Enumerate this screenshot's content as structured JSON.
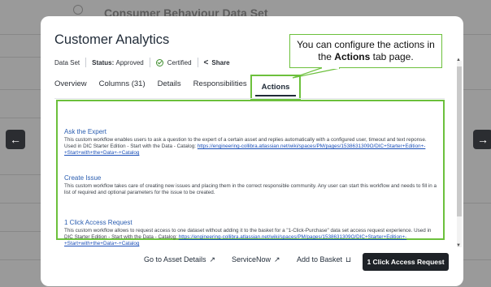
{
  "background": {
    "page_title": "Consumer Behaviour Data Set"
  },
  "navigation": {
    "prev_icon": "←",
    "next_icon": "→"
  },
  "modal": {
    "title": "Customer Analytics",
    "meta": {
      "type": "Data Set",
      "status_label": "Status:",
      "status_value": "Approved",
      "certified": "Certified",
      "share": "Share"
    },
    "tabs": [
      {
        "label": "Overview"
      },
      {
        "label": "Columns (31)"
      },
      {
        "label": "Details"
      },
      {
        "label": "Responsibilities"
      },
      {
        "label": "Actions",
        "active": true
      }
    ],
    "actions": [
      {
        "title": "Ask the Expert",
        "description": "This custom workflow enables users to ask a question to the expert of a certain asset and replies automatically with a configured user, timeout and text reponse. Used in DIC Starter Edition - Start with the Data - Catalog: ",
        "link": "https://engineering-collibra.atlassian.net/wiki/spaces/PM/pages/1538631309O/DIC+Starter+Edition+-+Start+with+the+Data+-+Catalog"
      },
      {
        "title": "Create Issue",
        "description": "This custom workflow takes care of creating new issues and placing them in the correct responsible community. Any user can start this workflow and needs to fill in a list of required and optional parameters for the issue to be created.",
        "link": ""
      },
      {
        "title": "1 Click Access Request",
        "description": "This custom workflow allows to request access to one dataset without adding it to the basket for a \"1-Click-Purchase\" data set access request experience. Used in DIC Starter Edition - Start with the Data - Catalog: ",
        "link": "https://engineering-collibra.atlassian.net/wiki/spaces/PM/pages/1538631309O/DIC+Starter+Edition+-+Start+with+the+Data+-+Catalog"
      }
    ],
    "footer": {
      "asset_details": "Go to Asset Details",
      "servicenow": "ServiceNow",
      "add_to_basket": "Add to Basket",
      "primary": "1 Click Access Request"
    }
  },
  "callout": {
    "text_before": "You can configure the actions in the ",
    "text_bold": "Actions",
    "text_after": " tab page."
  },
  "colors": {
    "highlight": "#6cc03c",
    "primary_button": "#1e2227",
    "link": "#2a5db0"
  }
}
